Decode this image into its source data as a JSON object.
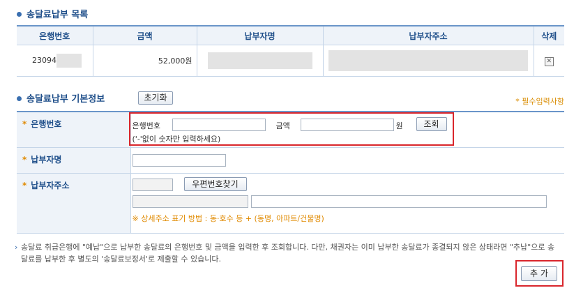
{
  "list_section": {
    "title": "송달료납부 목록"
  },
  "list_table": {
    "headers": [
      "은행번호",
      "금액",
      "납부자명",
      "납부자주소",
      "삭제"
    ],
    "rows": [
      {
        "bank_no": "23094",
        "amount": "52,000원",
        "delete_icon": "x-box-icon"
      }
    ]
  },
  "basic_section": {
    "title": "송달료납부 기본정보",
    "reset_label": "초기화",
    "required_note": "* 필수입력사항"
  },
  "form": {
    "bank_row": {
      "label": "은행번호",
      "bank_label": "은행번호",
      "amount_label": "금액",
      "unit": "원",
      "search_label": "조회",
      "hint": "('-'없이 숫자만 입력하세요)"
    },
    "payer_row": {
      "label": "납부자명"
    },
    "address_row": {
      "label": "납부자주소",
      "zip_button": "우편번호찾기",
      "note": "※ 상세주소 표기 방법 : 동·호수 등 + (동명, 아파트/건물명)"
    }
  },
  "notice": "송달료 취급은행에 \"예납\"으로 납부한 송달료의 은행번호 및 금액을 입력한 후 조회합니다. 다만, 채권자는 이미 납부한 송달료가 종결되지 않은 상태라면 \"추납\"으로 송달료를 납부한 후 별도의 '송달료보정서'로 제출할 수 있습니다.",
  "add_button": "추 가",
  "colors": {
    "accent": "#1f4f8a",
    "header_bg": "#eef3f9",
    "highlight": "#d9262c",
    "required": "#e08a00"
  }
}
